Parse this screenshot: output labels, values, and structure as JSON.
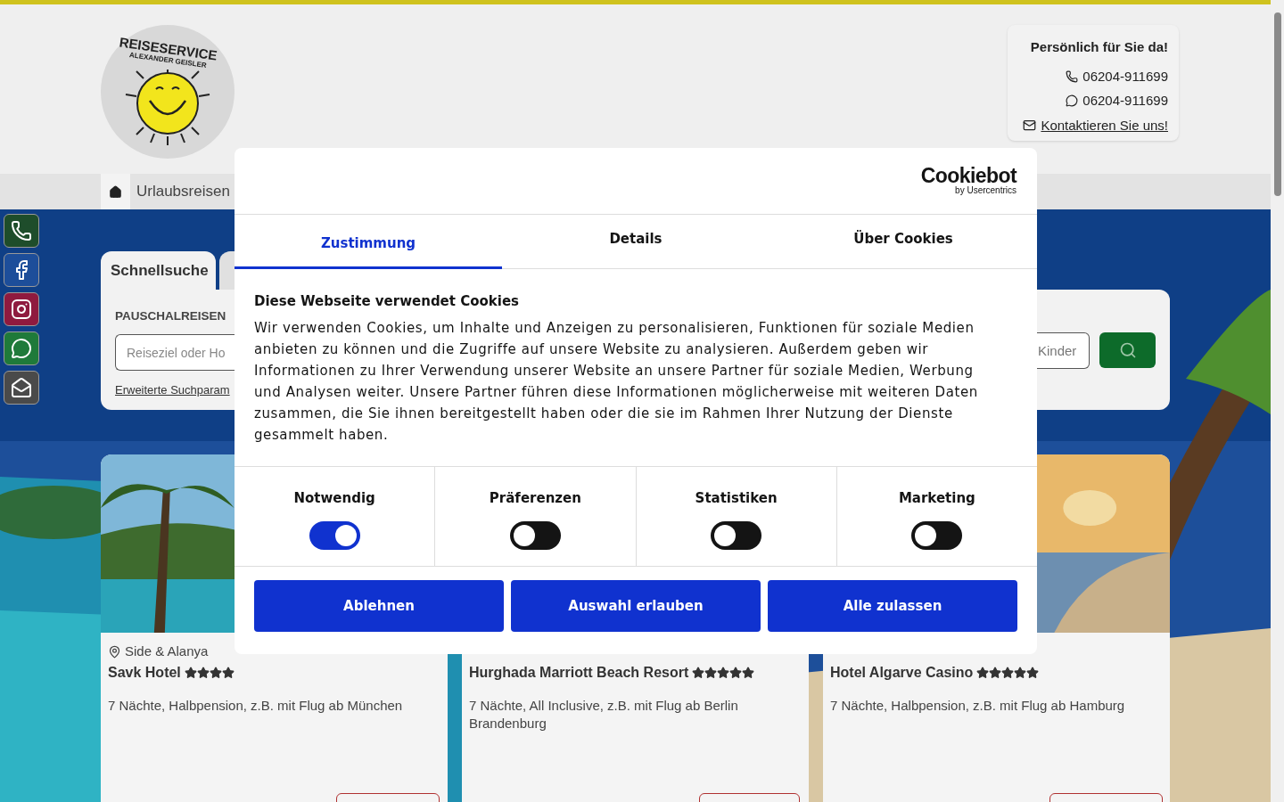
{
  "header": {
    "logo": {
      "title": "REISESERVICE",
      "subtitle": "ALEXANDER GEISLER"
    },
    "contact": {
      "heading": "Persönlich für Sie da!",
      "phone": "06204-911699",
      "whatsapp": "06204-911699",
      "link": "Kontaktieren Sie uns!"
    }
  },
  "nav": {
    "items": [
      {
        "kind": "home",
        "selected": true
      },
      {
        "kind": "menu",
        "label": "Urlaubsreisen",
        "selected": false
      }
    ]
  },
  "social": [
    {
      "kind": "phone",
      "color": "#1e4d2b"
    },
    {
      "kind": "facebook",
      "color": "#1d4e9a"
    },
    {
      "kind": "instagram",
      "color": "#8f1a3f"
    },
    {
      "kind": "whatsapp",
      "color": "#1f7a3a"
    },
    {
      "kind": "mail",
      "color": "#4a4a4a"
    }
  ],
  "search": {
    "tabs": [
      {
        "label": "Schnellsuche",
        "selected": true
      },
      {
        "selected": false
      }
    ],
    "section_label": "PAUSCHALREISEN",
    "destination": {
      "placeholder": "Reiseziel oder Ho"
    },
    "children": {
      "placeholder": "Kinder"
    },
    "advanced_link": "Erweiterte Suchparam"
  },
  "offers": [
    {
      "location": "Side & Alanya",
      "name": "Savk Hotel",
      "stars": 4,
      "description": "7 Nächte, Halbpension, z.B. mit Flug ab München"
    },
    {
      "name": "Hurghada Marriott Beach Resort",
      "stars": 5,
      "description": "7 Nächte, All Inclusive, z.B. mit Flug ab Berlin Brandenburg"
    },
    {
      "name": "Hotel Algarve Casino",
      "stars": 5,
      "description": "7 Nächte, Halbpension, z.B. mit Flug ab Hamburg"
    }
  ],
  "cookie_dialog": {
    "brand": "Cookiebot",
    "brand_sub": "by Usercentrics",
    "tabs": [
      {
        "label": "Zustimmung",
        "selected": true
      },
      {
        "label": "Details",
        "selected": false
      },
      {
        "label": "Über Cookies",
        "selected": false
      }
    ],
    "heading": "Diese Webseite verwendet Cookies",
    "text": "Wir verwenden Cookies, um Inhalte und Anzeigen zu personalisieren, Funktionen für soziale Medien anbieten zu können und die Zugriffe auf unsere Website zu analysieren. Außerdem geben wir Informationen zu Ihrer Verwendung unserer Website an unsere Partner für soziale Medien, Werbung und Analysen weiter. Unsere Partner führen diese Informationen möglicherweise mit weiteren Daten zusammen, die Sie ihnen bereitgestellt haben oder die sie im Rahmen Ihrer Nutzung der Dienste gesammelt haben.",
    "categories": [
      {
        "label": "Notwendig",
        "on": true
      },
      {
        "label": "Präferenzen",
        "on": false
      },
      {
        "label": "Statistiken",
        "on": false
      },
      {
        "label": "Marketing",
        "on": false
      }
    ],
    "buttons": [
      "Ablehnen",
      "Auswahl erlauben",
      "Alle zulassen"
    ]
  }
}
